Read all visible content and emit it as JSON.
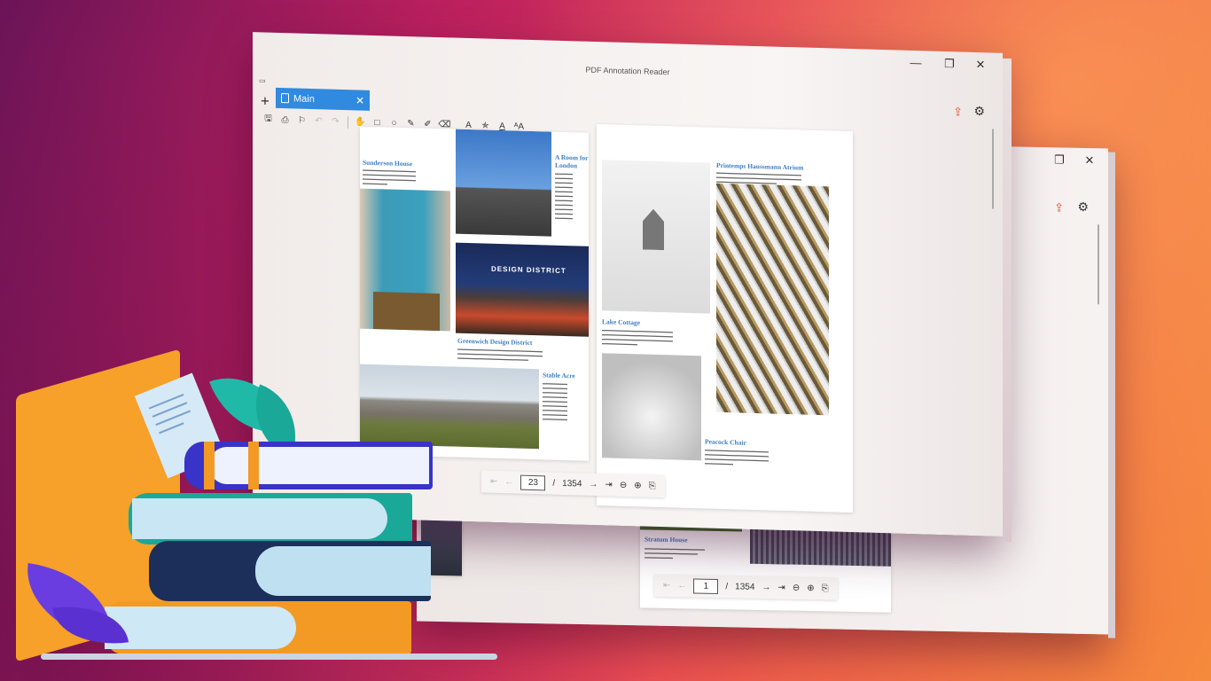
{
  "colors": {
    "accent": "#2f8ae0",
    "share": "#e0553a",
    "heading": "#3f7fc4"
  },
  "window": {
    "title": "PDF Annotation Reader",
    "controls": {
      "minimize": "—",
      "maximize": "❐",
      "close": "✕"
    },
    "sys_icon": "▭"
  },
  "tabs": [
    {
      "label": "Main",
      "close": "✕"
    }
  ],
  "tab_add": "+",
  "header_actions": {
    "share_icon": "share-icon",
    "settings_icon": "gear-icon"
  },
  "toolbar": [
    {
      "icon": "save-icon",
      "glyph": "🖫"
    },
    {
      "icon": "print-icon",
      "glyph": "⎙"
    },
    {
      "icon": "bookmark-icon",
      "glyph": "⚐"
    },
    {
      "icon": "undo-icon",
      "glyph": "↶"
    },
    {
      "icon": "redo-icon",
      "glyph": "↷"
    },
    {
      "icon": "hand-icon",
      "glyph": "✋"
    },
    {
      "icon": "rectangle-icon",
      "glyph": "□"
    },
    {
      "icon": "ellipse-icon",
      "glyph": "○"
    },
    {
      "icon": "pen-icon",
      "glyph": "✎"
    },
    {
      "icon": "highlighter-icon",
      "glyph": "✐"
    },
    {
      "icon": "eraser-icon",
      "glyph": "⌫"
    },
    {
      "icon": "text-color-icon",
      "glyph": "A"
    },
    {
      "icon": "text-star-icon",
      "glyph": "✯"
    },
    {
      "icon": "underline-icon",
      "glyph": "A"
    },
    {
      "icon": "font-size-icon",
      "glyph": "ᴬA"
    }
  ],
  "document": {
    "left_page": {
      "h1": "Sunderson House",
      "h2": "A Room for London",
      "h3": "Greenwich Design District",
      "h4": "Stable Acre",
      "sign": "DESIGN DISTRICT"
    },
    "right_page": {
      "h1": "Printemps Haussmann Atrium",
      "h2": "Lake Cottage",
      "h3": "Peacock Chair"
    }
  },
  "nav_front": {
    "first": "⇤",
    "prev": "←",
    "page": "23",
    "sep": "/",
    "total": "1354",
    "next": "→",
    "last": "⇥",
    "zoom_out": "⊖",
    "zoom_in": "⊕",
    "fit": "⎘"
  },
  "nav_back": {
    "first": "⇤",
    "prev": "←",
    "page": "1",
    "sep": "/",
    "total": "1354",
    "next": "→",
    "last": "⇥",
    "zoom_out": "⊖",
    "zoom_in": "⊕",
    "fit": "⎘"
  },
  "back_window": {
    "controls": {
      "maximize": "❐",
      "close": "✕"
    },
    "page_heading": "Stratum House"
  }
}
